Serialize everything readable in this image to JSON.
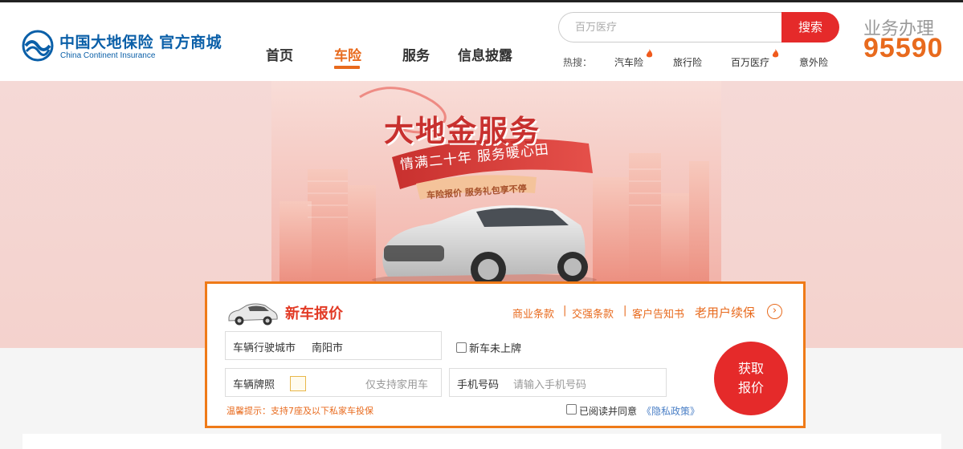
{
  "header": {
    "logo_cn": "中国大地保险  官方商城",
    "logo_en": "China Continent Insurance",
    "nav": [
      "首页",
      "车险",
      "服务",
      "信息披露"
    ],
    "active_nav": "车险",
    "search": {
      "placeholder": "百万医疗",
      "button": "搜索"
    },
    "hot": {
      "label": "热搜：",
      "items": [
        "汽车险",
        "旅行险",
        "百万医疗",
        "意外险"
      ]
    },
    "hotline": {
      "title": "业务办理",
      "number": "95590"
    }
  },
  "banner": {
    "title": "大地金服务",
    "subtitle": "情满二十年  服务暖心田",
    "tag": "车险报价 服务礼包享不停"
  },
  "quote": {
    "title": "新车报价",
    "links": [
      "商业条款",
      "交强条款",
      "客户告知书"
    ],
    "separator": "|",
    "renew": "老用户续保",
    "renew_icon": "chevron-right-icon",
    "city_label": "车辆行驶城市",
    "city_value": "南阳市",
    "new_car_label": "新车未上牌",
    "plate_label": "车辆牌照",
    "plate_hint": "仅支持家用车",
    "phone_label": "手机号码",
    "phone_placeholder": "请输入手机号码",
    "tip": "温馨提示：支持7座及以下私家车投保",
    "agree_label": "已阅读并同意",
    "privacy_link": "《隐私政策》",
    "submit_line1": "获取",
    "submit_line2": "报价"
  },
  "colors": {
    "brand_blue": "#0a5fa8",
    "accent_orange": "#e86a1d",
    "red": "#e52a2a"
  }
}
